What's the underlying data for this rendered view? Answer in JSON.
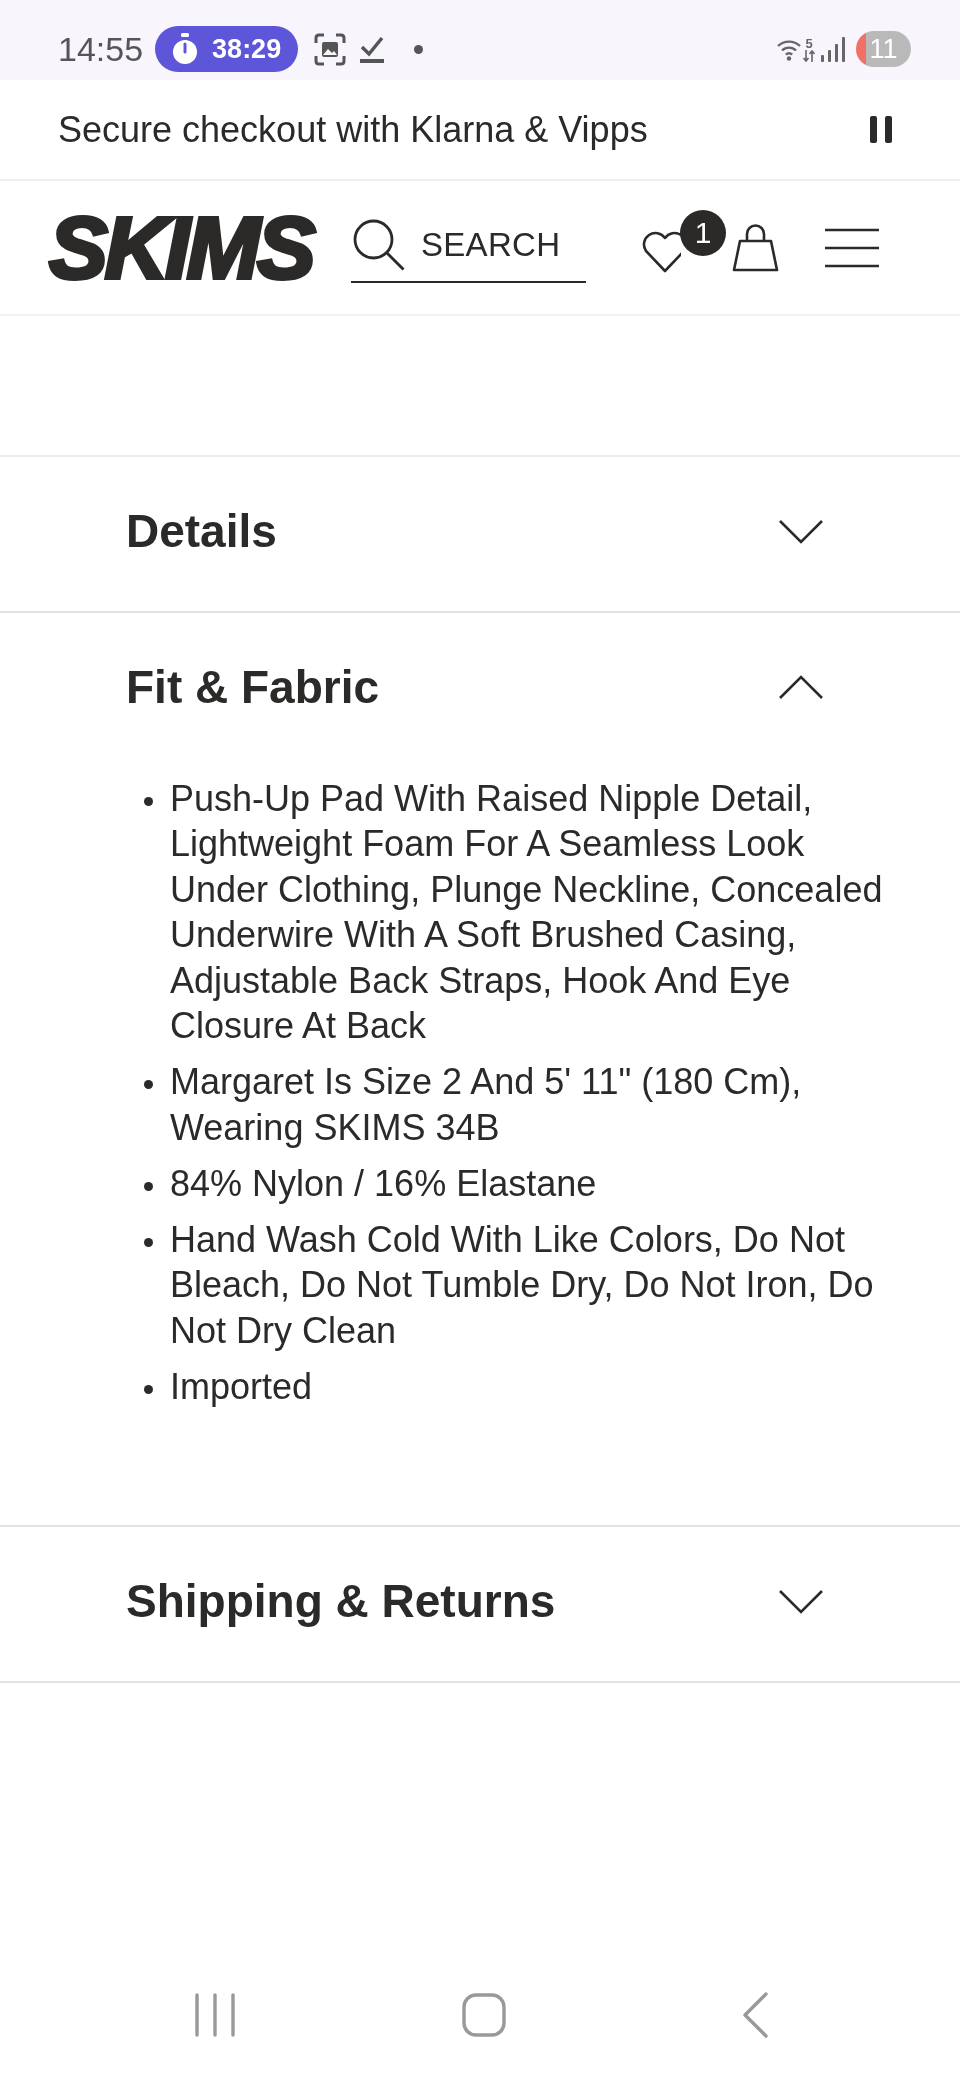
{
  "status_bar": {
    "time": "14:55",
    "timer": "38:29",
    "wifi_band": "5",
    "battery": "11"
  },
  "promo_banner": {
    "text": "Secure checkout with Klarna & Vipps"
  },
  "header": {
    "logo": "SKIMS",
    "search_label": "SEARCH",
    "wishlist_count": "1"
  },
  "accordion": [
    {
      "title": "Details",
      "expanded": false
    },
    {
      "title": "Fit & Fabric",
      "expanded": true,
      "items": [
        "Push-Up Pad With Raised Nipple Detail, Lightweight Foam For A Seamless Look Under Clothing, Plunge Neckline, Concealed Underwire With A Soft Brushed Casing, Adjustable Back Straps, Hook And Eye Closure At Back",
        "Margaret Is Size 2 And 5' 11\" (180 Cm), Wearing SKIMS 34B",
        "84% Nylon / 16% Elastane",
        "Hand Wash Cold With Like Colors, Do Not Bleach, Do Not Tumble Dry, Do Not Iron, Do Not Dry Clean",
        "Imported"
      ]
    },
    {
      "title": "Shipping & Returns",
      "expanded": false
    }
  ]
}
